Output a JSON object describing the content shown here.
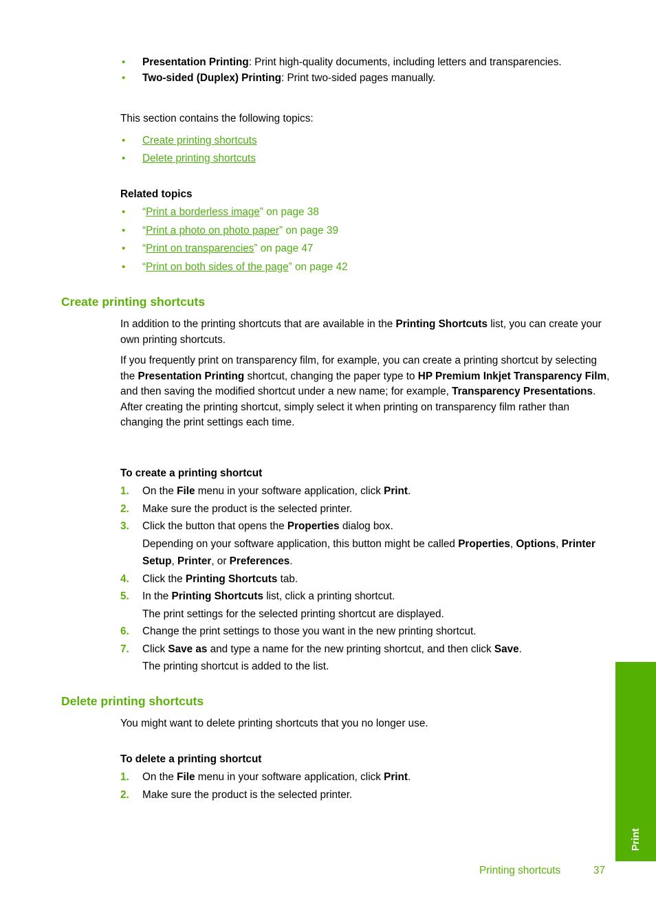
{
  "page": {
    "number": "37",
    "footer_section": "Printing shortcuts",
    "side_tab_label": "Print",
    "accent_green": "#5cb00a",
    "tab_green": "#55b004",
    "link_green": "#4fae10"
  },
  "intro": {
    "feature_bullets": [
      {
        "term": "Presentation Printing",
        "rest": ": Print high-quality documents, including letters and transparencies."
      },
      {
        "term": "Two-sided (Duplex) Printing",
        "rest": ": Print two-sided pages manually."
      }
    ],
    "toc_lead": "This section contains the following topics:",
    "toc_links": [
      "Create printing shortcuts",
      "Delete printing shortcuts"
    ]
  },
  "related_topics": {
    "heading": "Related topics",
    "items": [
      {
        "open_quote": "“",
        "link": "Print a borderless image",
        "close_quote": "”",
        "tail": " on page 38"
      },
      {
        "open_quote": "“",
        "link": "Print a photo on photo paper",
        "close_quote": "”",
        "tail": " on page 39"
      },
      {
        "open_quote": "“",
        "link": "Print on transparencies",
        "close_quote": "”",
        "tail": " on page 47"
      },
      {
        "open_quote": "“",
        "link": "Print on both sides of the page",
        "close_quote": "”",
        "tail": " on page 42"
      }
    ]
  },
  "create_section": {
    "heading": "Create printing shortcuts",
    "para1_a": "In addition to the printing shortcuts that are available in the ",
    "para1_b": "Printing Shortcuts",
    "para1_c": " list, you can create your own printing shortcuts.",
    "para2_a": "If you frequently print on transparency film, for example, you can create a printing shortcut by selecting the ",
    "para2_b1": "Presentation Printing",
    "para2_c": " shortcut, changing the paper type to ",
    "para2_b2": "HP Premium Inkjet Transparency Film",
    "para2_d": ", and then saving the modified shortcut under a new name; for example, ",
    "para2_b3": "Transparency Presentations",
    "para2_e": ". After creating the printing shortcut, simply select it when printing on transparency film rather than changing the print settings each time.",
    "proc_heading": "To create a printing shortcut",
    "steps": [
      {
        "num": "1.",
        "parts": [
          {
            "t": "On the ",
            "bold": false
          },
          {
            "t": "File",
            "bold": true
          },
          {
            "t": " menu in your software application, click ",
            "bold": false
          },
          {
            "t": "Print",
            "bold": true
          },
          {
            "t": ".",
            "bold": false
          }
        ],
        "sub": []
      },
      {
        "num": "2.",
        "parts": [
          {
            "t": "Make sure the product is the selected printer.",
            "bold": false
          }
        ],
        "sub": []
      },
      {
        "num": "3.",
        "parts": [
          {
            "t": "Click the button that opens the ",
            "bold": false
          },
          {
            "t": "Properties",
            "bold": true
          },
          {
            "t": " dialog box.",
            "bold": false
          }
        ],
        "sub": [
          [
            {
              "t": "Depending on your software application, this button might be called ",
              "bold": false
            },
            {
              "t": "Properties",
              "bold": true
            },
            {
              "t": ", ",
              "bold": false
            },
            {
              "t": "Options",
              "bold": true
            },
            {
              "t": ", ",
              "bold": false
            },
            {
              "t": "Printer Setup",
              "bold": true
            },
            {
              "t": ", ",
              "bold": false
            },
            {
              "t": "Printer",
              "bold": true
            },
            {
              "t": ", or ",
              "bold": false
            },
            {
              "t": "Preferences",
              "bold": true
            },
            {
              "t": ".",
              "bold": false
            }
          ]
        ]
      },
      {
        "num": "4.",
        "parts": [
          {
            "t": "Click the ",
            "bold": false
          },
          {
            "t": "Printing Shortcuts",
            "bold": true
          },
          {
            "t": " tab.",
            "bold": false
          }
        ],
        "sub": []
      },
      {
        "num": "5.",
        "parts": [
          {
            "t": "In the ",
            "bold": false
          },
          {
            "t": "Printing Shortcuts",
            "bold": true
          },
          {
            "t": " list, click a printing shortcut.",
            "bold": false
          }
        ],
        "sub": [
          [
            {
              "t": "The print settings for the selected printing shortcut are displayed.",
              "bold": false
            }
          ]
        ]
      },
      {
        "num": "6.",
        "parts": [
          {
            "t": "Change the print settings to those you want in the new printing shortcut.",
            "bold": false
          }
        ],
        "sub": []
      },
      {
        "num": "7.",
        "parts": [
          {
            "t": "Click ",
            "bold": false
          },
          {
            "t": "Save as",
            "bold": true
          },
          {
            "t": " and type a name for the new printing shortcut, and then click ",
            "bold": false
          },
          {
            "t": "Save",
            "bold": true
          },
          {
            "t": ".",
            "bold": false
          }
        ],
        "sub": [
          [
            {
              "t": "The printing shortcut is added to the list.",
              "bold": false
            }
          ]
        ]
      }
    ]
  },
  "delete_section": {
    "heading": "Delete printing shortcuts",
    "para1": "You might want to delete printing shortcuts that you no longer use.",
    "proc_heading": "To delete a printing shortcut",
    "steps": [
      {
        "num": "1.",
        "parts": [
          {
            "t": "On the ",
            "bold": false
          },
          {
            "t": "File",
            "bold": true
          },
          {
            "t": " menu in your software application, click ",
            "bold": false
          },
          {
            "t": "Print",
            "bold": true
          },
          {
            "t": ".",
            "bold": false
          }
        ],
        "sub": []
      },
      {
        "num": "2.",
        "parts": [
          {
            "t": "Make sure the product is the selected printer.",
            "bold": false
          }
        ],
        "sub": []
      }
    ]
  }
}
